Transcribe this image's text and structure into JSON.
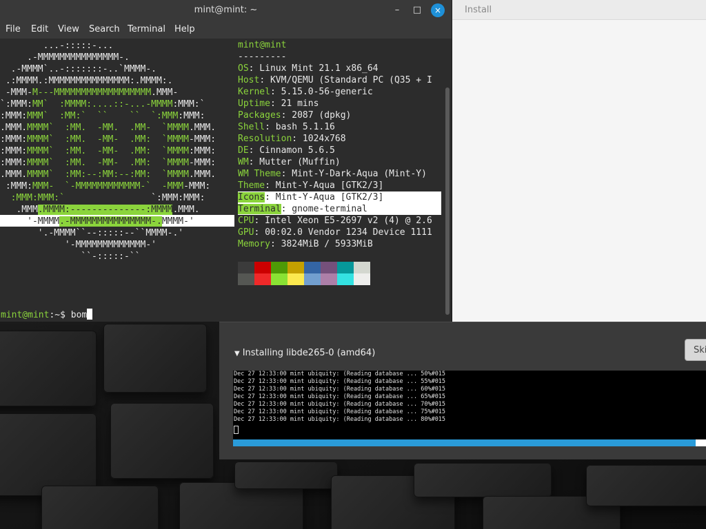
{
  "terminal": {
    "title": "mint@mint: ~",
    "menu": [
      "File",
      "Edit",
      "View",
      "Search",
      "Terminal",
      "Help"
    ],
    "close_icon": "×",
    "minimize_icon": "–",
    "maximize_icon": "□",
    "logo_lines": [
      "        ...-:::::-...",
      "     .-MMMMMMMMMMMMMMM-.",
      "  .-MMMM`..-:::::::-..`MMMM-.",
      " .:MMMM.:MMMMMMMMMMMMMMM:.MMMM:.",
      " -MMM-M---MMMMMMMMMMMMMMMMMM.MMM-",
      "`:MMM:MM`  :MMMM:....::-...-MMMM:MMM:`",
      ":MMM:MMM`  :MM:`  ``    ``  `:MMM:MMM:",
      ".MMM.MMMM`  :MM.  -MM.  .MM-  `MMMM.MMM.",
      ":MMM:MMMM`  :MM.  -MM-  .MM:  `MMMM-MMM:",
      ":MMM:MMMM`  :MM.  -MM-  .MM:  `MMMM:MMM:",
      ":MMM:MMMM`  :MM.  -MM-  .MM:  `MMMM-MMM:",
      ".MMM.MMMM`  :MM:--:MM:--:MM:  `MMMM.MMM.",
      " :MMM:MMM-  `-MMMMMMMMMMMM-`  -MMM-MMM:",
      "  :MMM:MMM:`                `:MMM:MMM:",
      "   .MMM.MMMM:--------------:MMMM.MMM.",
      "     '-MMMM.-MMMMMMMMMMMMMMM-.MMMM-'",
      "       '.-MMMM``--:::::--``MMMM-.'",
      "            '-MMMMMMMMMMMMM-'",
      "               ``-:::::-``"
    ],
    "header": "mint@mint",
    "separator": "---------",
    "info": [
      {
        "key": "OS",
        "value": "Linux Mint 21.1 x86_64"
      },
      {
        "key": "Host",
        "value": "KVM/QEMU (Standard PC (Q35 + I"
      },
      {
        "key": "Kernel",
        "value": "5.15.0-56-generic"
      },
      {
        "key": "Uptime",
        "value": "21 mins"
      },
      {
        "key": "Packages",
        "value": "2087 (dpkg)"
      },
      {
        "key": "Shell",
        "value": "bash 5.1.16"
      },
      {
        "key": "Resolution",
        "value": "1024x768"
      },
      {
        "key": "DE",
        "value": "Cinnamon 5.6.5"
      },
      {
        "key": "WM",
        "value": "Mutter (Muffin)"
      },
      {
        "key": "WM Theme",
        "value": "Mint-Y-Dark-Aqua (Mint-Y)"
      },
      {
        "key": "Theme",
        "value": "Mint-Y-Aqua [GTK2/3]"
      },
      {
        "key": "Icons",
        "value": "Mint-Y-Aqua [GTK2/3]"
      },
      {
        "key": "Terminal",
        "value": "gnome-terminal"
      },
      {
        "key": "CPU",
        "value": "Intel Xeon E5-2697 v2 (4) @ 2.6"
      },
      {
        "key": "GPU",
        "value": "00:02.0 Vendor 1234 Device 1111"
      },
      {
        "key": "Memory",
        "value": "3824MiB / 5933MiB"
      }
    ],
    "palette_top": [
      "#3b3b3b",
      "#cc0000",
      "#4e9a06",
      "#c4a000",
      "#3465a4",
      "#75507b",
      "#06989a",
      "#d3d7cf"
    ],
    "palette_bottom": [
      "#555753",
      "#ef2929",
      "#8ae234",
      "#fce94f",
      "#729fcf",
      "#ad7fa8",
      "#34e2e2",
      "#eeeeec"
    ],
    "prompt_user": "mint@mint",
    "prompt_path": ":~$ ",
    "command": "bom"
  },
  "installer": {
    "title": "Install",
    "details_label": "Installing libde265-0 (amd64)",
    "skip_label": "Ski",
    "log_lines": [
      "Dec 27 12:33:00 mint ubiquity: (Reading database ... 50%#015",
      "Dec 27 12:33:00 mint ubiquity: (Reading database ... 55%#015",
      "Dec 27 12:33:00 mint ubiquity: (Reading database ... 60%#015",
      "Dec 27 12:33:00 mint ubiquity: (Reading database ... 65%#015",
      "Dec 27 12:33:00 mint ubiquity: (Reading database ... 70%#015",
      "Dec 27 12:33:00 mint ubiquity: (Reading database ... 75%#015",
      "Dec 27 12:33:00 mint ubiquity: (Reading database ... 80%#015"
    ],
    "progress_fraction": 0.978
  }
}
